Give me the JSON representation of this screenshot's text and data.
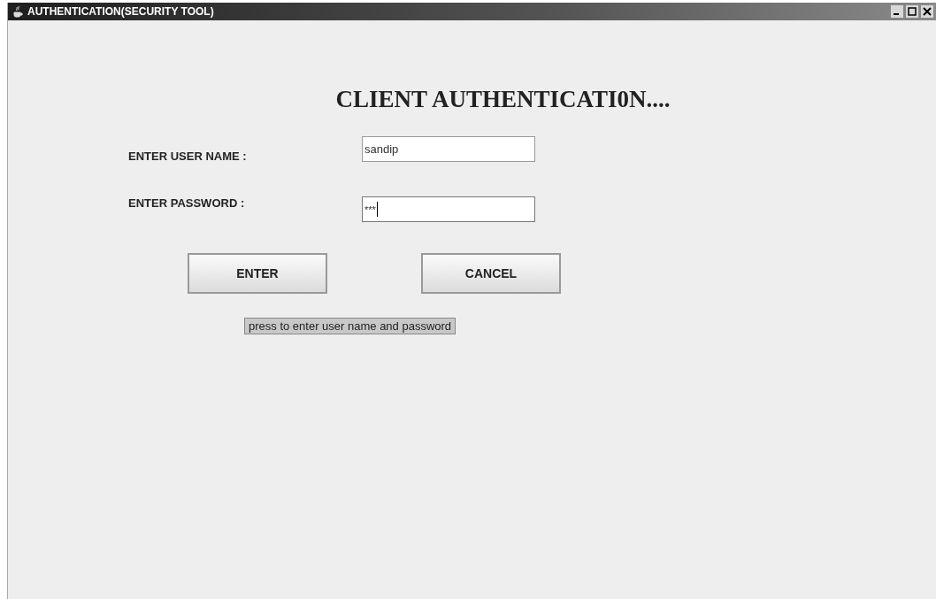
{
  "window": {
    "title": "AUTHENTICATION(SECURITY TOOL)"
  },
  "heading": "CLIENT AUTHENTICATI0N....",
  "fields": [
    {
      "label": "ENTER USER NAME :",
      "value": "sandip",
      "focused": false
    },
    {
      "label": "ENTER PASSWORD :",
      "value": "***",
      "focused": true
    }
  ],
  "buttons": [
    "ENTER",
    "CANCEL"
  ],
  "tooltip": "press to enter user name and password"
}
